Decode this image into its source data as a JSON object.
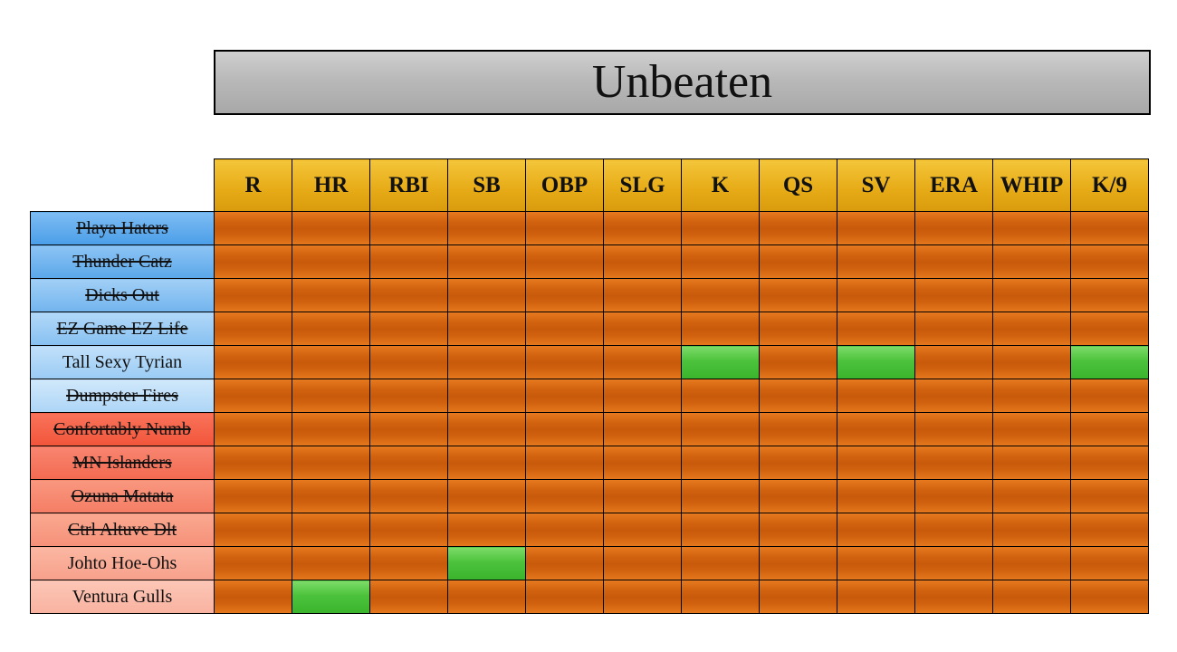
{
  "title": "Unbeaten",
  "categories": [
    "R",
    "HR",
    "RBI",
    "SB",
    "OBP",
    "SLG",
    "K",
    "QS",
    "SV",
    "ERA",
    "WHIP",
    "K/9"
  ],
  "teams": [
    {
      "name": "Playa Haters",
      "division": "blue",
      "eliminated": true,
      "unbeaten": []
    },
    {
      "name": "Thunder Catz",
      "division": "blue",
      "eliminated": true,
      "unbeaten": []
    },
    {
      "name": "Dicks Out ",
      "division": "blue",
      "eliminated": true,
      "unbeaten": []
    },
    {
      "name": "EZ Game EZ Life",
      "division": "blue",
      "eliminated": true,
      "unbeaten": []
    },
    {
      "name": "Tall Sexy Tyrian",
      "division": "blue",
      "eliminated": false,
      "unbeaten": [
        "K",
        "SV",
        "K/9"
      ]
    },
    {
      "name": "Dumpster Fires",
      "division": "blue",
      "eliminated": true,
      "unbeaten": []
    },
    {
      "name": "Confortably Numb",
      "division": "red",
      "eliminated": true,
      "unbeaten": []
    },
    {
      "name": "MN Islanders",
      "division": "red",
      "eliminated": true,
      "unbeaten": []
    },
    {
      "name": "Ozuna Matata",
      "division": "red",
      "eliminated": true,
      "unbeaten": []
    },
    {
      "name": "Ctrl Altuve Dlt",
      "division": "red",
      "eliminated": true,
      "unbeaten": []
    },
    {
      "name": "Johto Hoe-Ohs",
      "division": "red",
      "eliminated": false,
      "unbeaten": [
        "SB"
      ]
    },
    {
      "name": "Ventura Gulls",
      "division": "red",
      "eliminated": false,
      "unbeaten": [
        "HR"
      ]
    }
  ],
  "colors": {
    "header": "#e7ac18",
    "cell": "#d0620f",
    "unbeaten_cell": "#4cc23c",
    "blue_division": "#4a9ee8",
    "red_division": "#f2553a"
  }
}
